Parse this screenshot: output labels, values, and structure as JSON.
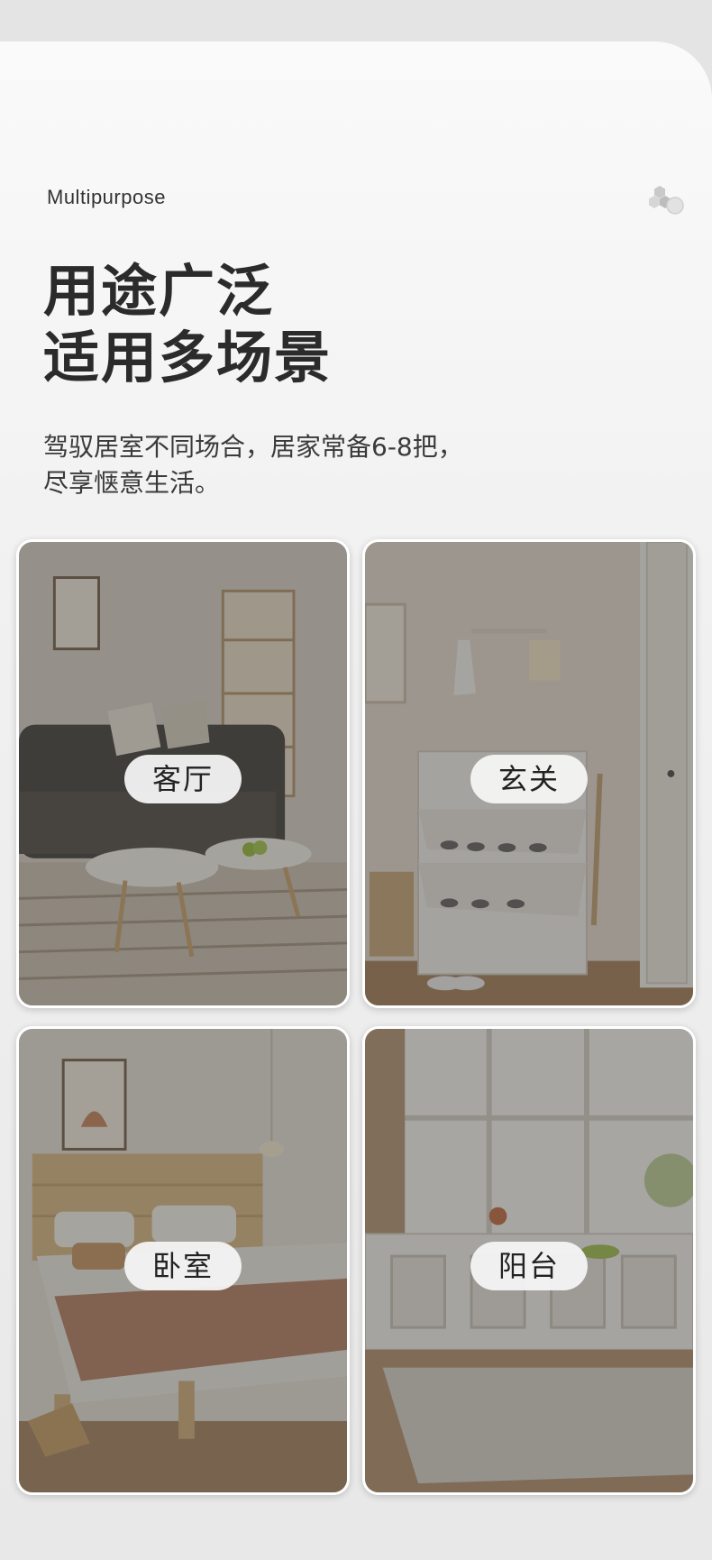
{
  "header": {
    "subtitle_en": "Multipurpose",
    "title_line1": "用途广泛",
    "title_line2": "适用多场景",
    "desc_line1": "驾驭居室不同场合，居家常备6-8把，",
    "desc_line2": "尽享惬意生活。",
    "brand_mark_icon": "hexagon-cluster-icon"
  },
  "scenes": [
    {
      "label": "客厅",
      "icon": "living-room-photo"
    },
    {
      "label": "玄关",
      "icon": "entryway-photo"
    },
    {
      "label": "卧室",
      "icon": "bedroom-photo"
    },
    {
      "label": "阳台",
      "icon": "balcony-photo"
    }
  ],
  "colors": {
    "background": "#e4e4e4",
    "title": "#2b2b2b",
    "pill": "#f5f5f5"
  }
}
